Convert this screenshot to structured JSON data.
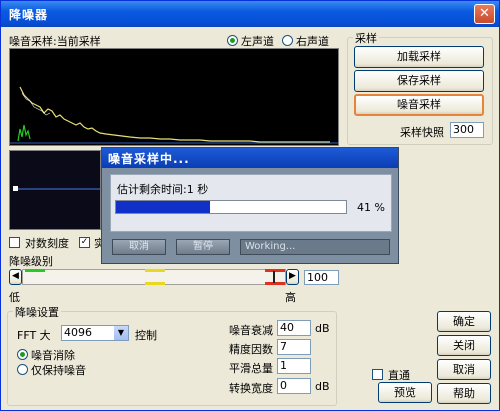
{
  "window": {
    "title": "降噪器",
    "close_glyph": "✕"
  },
  "spectrum_header": {
    "label": "噪音采样:当前采样",
    "left_channel": "左声道",
    "right_channel": "右声道",
    "selected_channel": "left"
  },
  "sampling_group": {
    "title": "采样",
    "load_button": "加载采样",
    "save_button": "保存采样",
    "noise_button": "噪音采样",
    "snapshot_label": "采样快照",
    "snapshot_value": "300"
  },
  "options": {
    "log_scale_label": "对数刻度",
    "log_scale_checked": false,
    "second_check_label": "实",
    "second_check_checked": true
  },
  "noise_level": {
    "label": "降噪级别",
    "value": "100",
    "low_label": "低",
    "high_label": "高",
    "fill_fraction": 1.0
  },
  "settings_group": {
    "title": "降噪设置",
    "fft_label": "FFT 大",
    "fft_value": "4096",
    "control_label": "控制",
    "mode_remove": "噪音消除",
    "mode_keep": "仅保持噪音",
    "selected_mode": "remove",
    "reduction_label": "噪音衰减",
    "reduction_value": "40",
    "reduction_unit": "dB",
    "precision_label": "精度因数",
    "precision_value": "7",
    "smoothing_label": "平滑总量",
    "smoothing_value": "1",
    "transition_label": "转换宽度",
    "transition_value": "0",
    "transition_unit": "dB"
  },
  "bottom": {
    "passthrough_label": "直通",
    "passthrough_checked": false,
    "preview_button": "预览",
    "ok_button": "确定",
    "close_button": "关闭",
    "cancel_button": "取消",
    "help_button": "帮助"
  },
  "progress_dialog": {
    "title": "噪音采样中...",
    "estimate_text": "估计剩余时间:1 秒",
    "percent_text": "41 %",
    "progress_fraction": 0.41,
    "cancel_button": "取消",
    "pause_button": "暂停",
    "status_text": "Working..."
  },
  "colors": {
    "title_bar": "#0a5ae0",
    "accent_focus": "#e8833a",
    "progress_fill": "#1030c8",
    "spectrum_bg": "#000000",
    "spectrum_trace": "#e8e070",
    "low_marker": "#28c828",
    "mid_marker": "#e8d820",
    "high_marker": "#e03020"
  }
}
